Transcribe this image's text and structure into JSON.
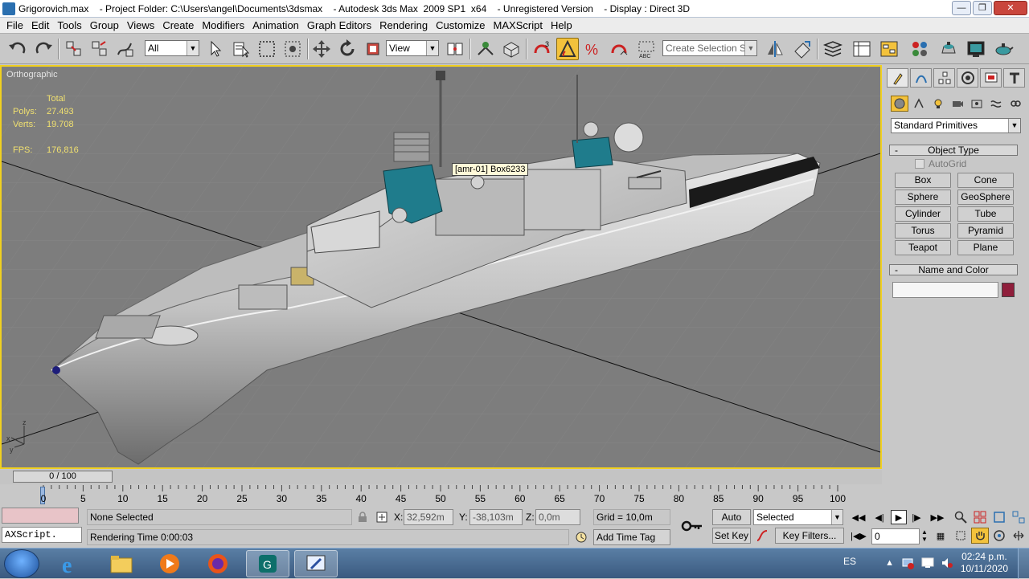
{
  "window": {
    "title": "Grigorovich.max    - Project Folder: C:\\Users\\angel\\Documents\\3dsmax    - Autodesk 3ds Max  2009 SP1  x64    - Unregistered Version    - Display : Direct 3D",
    "controls": [
      "minimize",
      "restore",
      "close"
    ]
  },
  "menu": [
    "File",
    "Edit",
    "Tools",
    "Group",
    "Views",
    "Create",
    "Modifiers",
    "Animation",
    "Graph Editors",
    "Rendering",
    "Customize",
    "MAXScript",
    "Help"
  ],
  "toolbar": {
    "filter_value": "All",
    "ref_coord_value": "View",
    "selection_set_placeholder": "Create Selection Set"
  },
  "viewport": {
    "label": "Orthographic",
    "stats": {
      "total_label": "Total",
      "polys_label": "Polys:",
      "polys_value": "27.493",
      "verts_label": "Verts:",
      "verts_value": "19.708",
      "fps_label": "FPS:",
      "fps_value": "176,816"
    },
    "tooltip": "[amr-01] Box6233",
    "axis_labels": {
      "z": "z",
      "x": "x",
      "y": "y"
    },
    "colors": {
      "background": "#7d7d7d",
      "border_active": "#f0d020",
      "stats": "#f0e070",
      "accent_teal": "#1f7c8c"
    }
  },
  "command_panel": {
    "object_category": "Standard Primitives",
    "object_type_title": "Object Type",
    "autogrid_label": "AutoGrid",
    "primitives": [
      "Box",
      "Cone",
      "Sphere",
      "GeoSphere",
      "Cylinder",
      "Tube",
      "Torus",
      "Pyramid",
      "Teapot",
      "Plane"
    ],
    "name_color_title": "Name and Color",
    "name_value": "",
    "object_color": "#8f1e3b"
  },
  "timeline": {
    "slider_label": "0 / 100",
    "tick_labels": [
      "0",
      "5",
      "10",
      "15",
      "20",
      "25",
      "30",
      "35",
      "40",
      "45",
      "50",
      "55",
      "60",
      "65",
      "70",
      "75",
      "80",
      "85",
      "90",
      "95",
      "100"
    ]
  },
  "status": {
    "maxscript_label": "AXScript.",
    "selection_status": "None Selected",
    "prompt": "Rendering Time  0:00:03",
    "x_label": "X:",
    "x_value": "32,592m",
    "y_label": "Y:",
    "y_value": "-38,103m",
    "z_label": "Z:",
    "z_value": "0,0m",
    "grid": "Grid = 10,0m",
    "add_time_tag": "Add Time Tag",
    "auto_key": "Auto Key",
    "set_key": "Set Key",
    "key_mode_value": "Selected",
    "key_filters": "Key Filters...",
    "frame_value": "0"
  },
  "taskbar": {
    "language": "ES",
    "time": "02:24 p.m.",
    "date": "10/11/2020",
    "apps": [
      "internet-explorer",
      "file-explorer",
      "media-player",
      "firefox",
      "3ds-max",
      "paint-app"
    ]
  }
}
